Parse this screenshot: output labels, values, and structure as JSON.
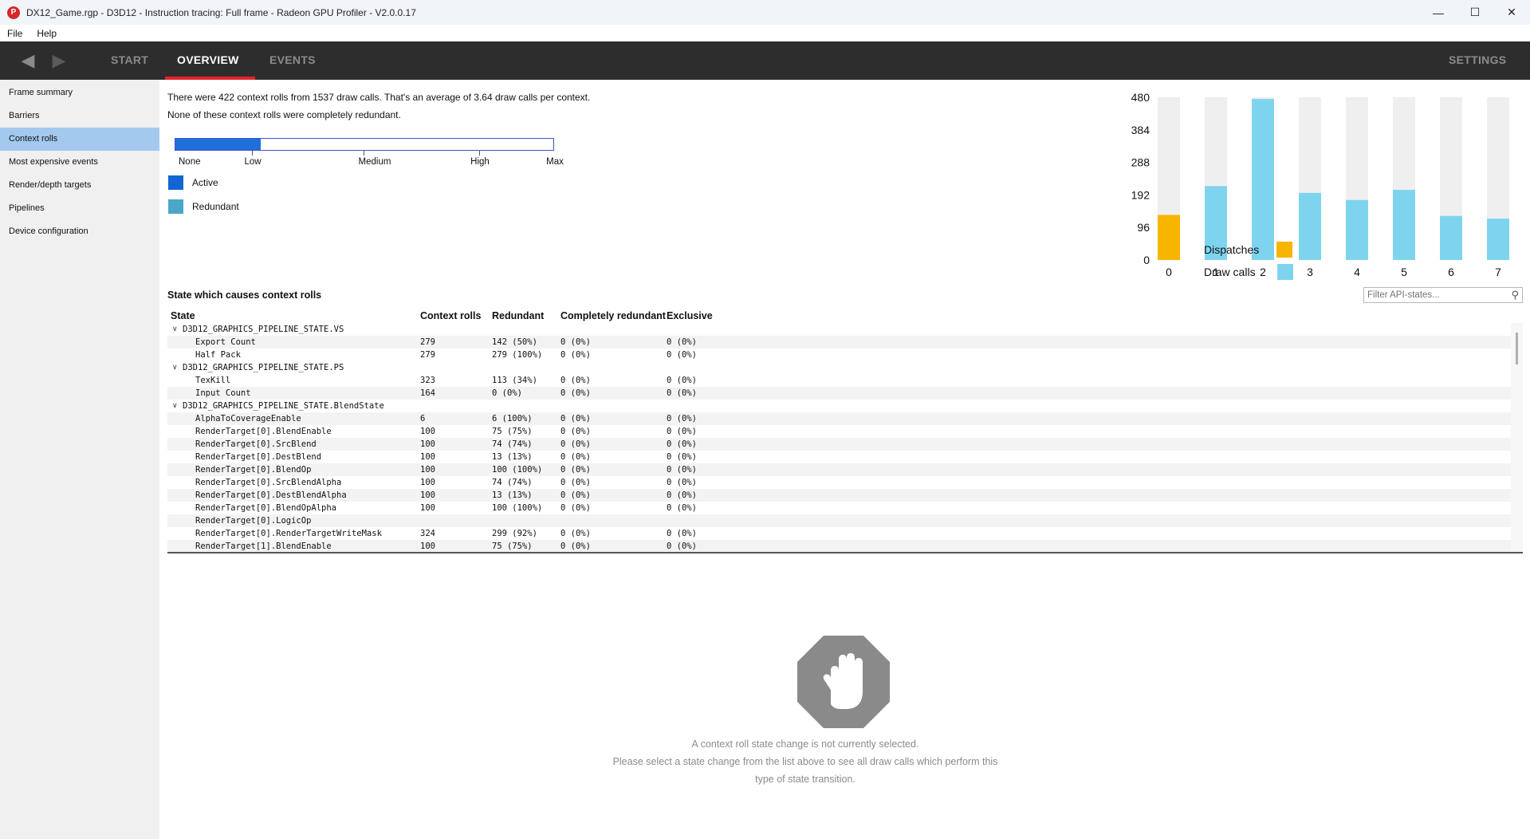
{
  "window": {
    "title": "DX12_Game.rgp - D3D12 - Instruction tracing: Full frame - Radeon GPU Profiler - V2.0.0.17",
    "icon_letter": "P",
    "controls": [
      "minimize-icon",
      "maximize-icon",
      "close-icon"
    ]
  },
  "menu": {
    "items": [
      "File",
      "Help"
    ]
  },
  "nav": {
    "tabs": [
      {
        "label": "START",
        "active": false
      },
      {
        "label": "OVERVIEW",
        "active": true
      },
      {
        "label": "EVENTS",
        "active": false
      }
    ],
    "settings_label": "SETTINGS"
  },
  "sidebar": {
    "items": [
      {
        "label": "Frame summary",
        "active": false
      },
      {
        "label": "Barriers",
        "active": false
      },
      {
        "label": "Context rolls",
        "active": true
      },
      {
        "label": "Most expensive events",
        "active": false
      },
      {
        "label": "Render/depth targets",
        "active": false
      },
      {
        "label": "Pipelines",
        "active": false
      },
      {
        "label": "Device configuration",
        "active": false
      }
    ]
  },
  "summary": {
    "line1": "There were 422 context rolls from 1537 draw calls. That's an average of 3.64 draw calls per context.",
    "line2": "None of these context rolls were completely redundant."
  },
  "meter": {
    "fill_fraction": 0.225,
    "labels": [
      "None",
      "Low",
      "Medium",
      "High",
      "Max"
    ]
  },
  "legend": {
    "active": {
      "label": "Active",
      "color": "#1266d4"
    },
    "redundant": {
      "label": "Redundant",
      "color": "#4aa7c9"
    }
  },
  "chart_legend": {
    "dispatches": {
      "label": "Dispatches",
      "color": "#f7b500"
    },
    "draw_calls": {
      "label": "Draw calls",
      "color": "#7ed4ee"
    }
  },
  "chart_data": {
    "type": "bar",
    "categories": [
      "0",
      "1",
      "2",
      "3",
      "4",
      "5",
      "6",
      "7"
    ],
    "series": [
      {
        "name": "Dispatches",
        "values": [
          133,
          0,
          0,
          0,
          0,
          0,
          0,
          0
        ]
      },
      {
        "name": "Draw calls",
        "values": [
          0,
          218,
          475,
          198,
          177,
          207,
          130,
          122
        ]
      }
    ],
    "ylim": [
      0,
      480
    ],
    "yticks": [
      "0",
      "96",
      "192",
      "288",
      "384",
      "480"
    ],
    "stacked": true,
    "background_track_color": "#efefef"
  },
  "table": {
    "section_title": "State which causes context rolls",
    "filter_placeholder": "Filter API-states...",
    "headers": [
      "State",
      "Context rolls",
      "Redundant",
      "Completely redundant",
      "Exclusive"
    ],
    "rows": [
      {
        "kind": "group",
        "state": "D3D12_GRAPHICS_PIPELINE_STATE.VS",
        "rolls": "",
        "redundant": "",
        "complete": "",
        "exclusive": ""
      },
      {
        "kind": "item",
        "state": "Export Count",
        "rolls": "279",
        "redundant": "142 (50%)",
        "complete": "0 (0%)",
        "exclusive": "0 (0%)"
      },
      {
        "kind": "item",
        "state": "Half Pack",
        "rolls": "279",
        "redundant": "279 (100%)",
        "complete": "0 (0%)",
        "exclusive": "0 (0%)"
      },
      {
        "kind": "group",
        "state": "D3D12_GRAPHICS_PIPELINE_STATE.PS",
        "rolls": "",
        "redundant": "",
        "complete": "",
        "exclusive": ""
      },
      {
        "kind": "item",
        "state": "TexKill",
        "rolls": "323",
        "redundant": "113 (34%)",
        "complete": "0 (0%)",
        "exclusive": "0 (0%)"
      },
      {
        "kind": "item",
        "state": "Input Count",
        "rolls": "164",
        "redundant": "0 (0%)",
        "complete": "0 (0%)",
        "exclusive": "0 (0%)"
      },
      {
        "kind": "group",
        "state": "D3D12_GRAPHICS_PIPELINE_STATE.BlendState",
        "rolls": "",
        "redundant": "",
        "complete": "",
        "exclusive": ""
      },
      {
        "kind": "item",
        "state": "AlphaToCoverageEnable",
        "rolls": "6",
        "redundant": "6 (100%)",
        "complete": "0 (0%)",
        "exclusive": "0 (0%)"
      },
      {
        "kind": "item",
        "state": "RenderTarget[0].BlendEnable",
        "rolls": "100",
        "redundant": "75 (75%)",
        "complete": "0 (0%)",
        "exclusive": "0 (0%)"
      },
      {
        "kind": "item",
        "state": "RenderTarget[0].SrcBlend",
        "rolls": "100",
        "redundant": "74 (74%)",
        "complete": "0 (0%)",
        "exclusive": "0 (0%)"
      },
      {
        "kind": "item",
        "state": "RenderTarget[0].DestBlend",
        "rolls": "100",
        "redundant": "13 (13%)",
        "complete": "0 (0%)",
        "exclusive": "0 (0%)"
      },
      {
        "kind": "item",
        "state": "RenderTarget[0].BlendOp",
        "rolls": "100",
        "redundant": "100 (100%)",
        "complete": "0 (0%)",
        "exclusive": "0 (0%)"
      },
      {
        "kind": "item",
        "state": "RenderTarget[0].SrcBlendAlpha",
        "rolls": "100",
        "redundant": "74 (74%)",
        "complete": "0 (0%)",
        "exclusive": "0 (0%)"
      },
      {
        "kind": "item",
        "state": "RenderTarget[0].DestBlendAlpha",
        "rolls": "100",
        "redundant": "13 (13%)",
        "complete": "0 (0%)",
        "exclusive": "0 (0%)"
      },
      {
        "kind": "item",
        "state": "RenderTarget[0].BlendOpAlpha",
        "rolls": "100",
        "redundant": "100 (100%)",
        "complete": "0 (0%)",
        "exclusive": "0 (0%)"
      },
      {
        "kind": "item",
        "state": "RenderTarget[0].LogicOp",
        "rolls": "",
        "redundant": "",
        "complete": "",
        "exclusive": ""
      },
      {
        "kind": "item",
        "state": "RenderTarget[0].RenderTargetWriteMask",
        "rolls": "324",
        "redundant": "299 (92%)",
        "complete": "0 (0%)",
        "exclusive": "0 (0%)"
      },
      {
        "kind": "item",
        "state": "RenderTarget[1].BlendEnable",
        "rolls": "100",
        "redundant": "75 (75%)",
        "complete": "0 (0%)",
        "exclusive": "0 (0%)"
      }
    ]
  },
  "empty_state": {
    "icon": "stop-hand-icon",
    "line1": "A context roll state change is not currently selected.",
    "line2": "Please select a state change from the list above to see all draw calls which perform this",
    "line3": "type of state transition."
  }
}
